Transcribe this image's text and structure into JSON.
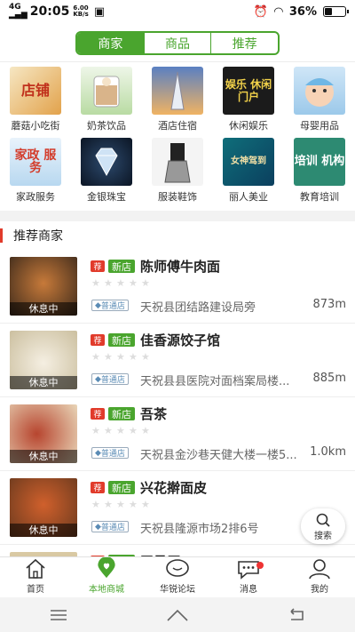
{
  "status_bar": {
    "network": "4G",
    "time": "20:05",
    "speed_top": "6.00",
    "speed_bottom": "KB/s",
    "battery": "36%",
    "battery_level": 0.36
  },
  "tabs": [
    {
      "label": "商家",
      "active": true
    },
    {
      "label": "商品",
      "active": false
    },
    {
      "label": "推荐",
      "active": false
    }
  ],
  "categories": [
    {
      "label": "蘑菇小吃街",
      "thumb_text": "店铺"
    },
    {
      "label": "奶茶饮品",
      "thumb_text": ""
    },
    {
      "label": "酒店住宿",
      "thumb_text": ""
    },
    {
      "label": "休闲娱乐",
      "thumb_text": "娱乐 休闲门户"
    },
    {
      "label": "母婴用品",
      "thumb_text": ""
    },
    {
      "label": "家政服务",
      "thumb_text": "家政 服务"
    },
    {
      "label": "金银珠宝",
      "thumb_text": ""
    },
    {
      "label": "服装鞋饰",
      "thumb_text": ""
    },
    {
      "label": "丽人美业",
      "thumb_text": "女神驾到"
    },
    {
      "label": "教育培训",
      "thumb_text": "培训 机构"
    }
  ],
  "section_title": "推荐商家",
  "shop_common": {
    "tag_recommend": "荐",
    "tag_new": "新店",
    "status": "休息中",
    "level": "普通店"
  },
  "shops": [
    {
      "name": "陈师傅牛肉面",
      "address": "天祝县团结路建设局旁",
      "distance": "873m"
    },
    {
      "name": "佳香源饺子馆",
      "address": "天祝县县医院对面档案局楼...",
      "distance": "885m"
    },
    {
      "name": "吾茶",
      "address": "天祝县金沙巷天健大楼一楼5...",
      "distance": "1.0km"
    },
    {
      "name": "兴花擀面皮",
      "address": "天祝县隆源市场2排6号",
      "distance": ""
    },
    {
      "name": "王曼厘",
      "address": "",
      "distance": ""
    }
  ],
  "fab": {
    "label": "搜索"
  },
  "bottom_nav": [
    {
      "label": "首页",
      "icon": "home-icon"
    },
    {
      "label": "本地商城",
      "icon": "location-heart-icon",
      "active": true
    },
    {
      "label": "华锐论坛",
      "icon": "chat-bubble-icon"
    },
    {
      "label": "消息",
      "icon": "message-icon",
      "badge": true
    },
    {
      "label": "我的",
      "icon": "user-icon"
    }
  ]
}
